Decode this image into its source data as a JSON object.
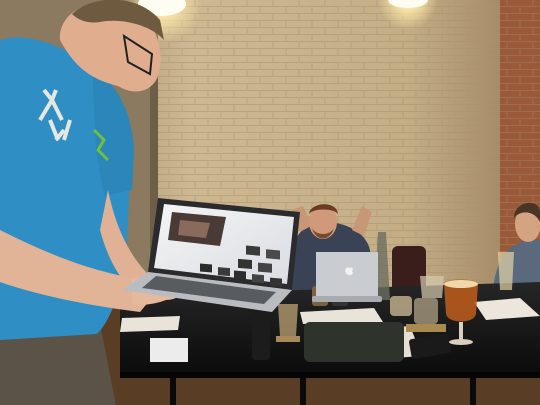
{
  "scene": {
    "kind": "photograph",
    "colors": {
      "brick_wall": "#c9b48f",
      "brick_light": "#e6d6b3",
      "table": "#141414",
      "floor": "#6b4a2c",
      "presenter_shirt": "#2f8fc4",
      "laptop_silver": "#c9ccd0",
      "beer": "#b85a1c"
    }
  }
}
